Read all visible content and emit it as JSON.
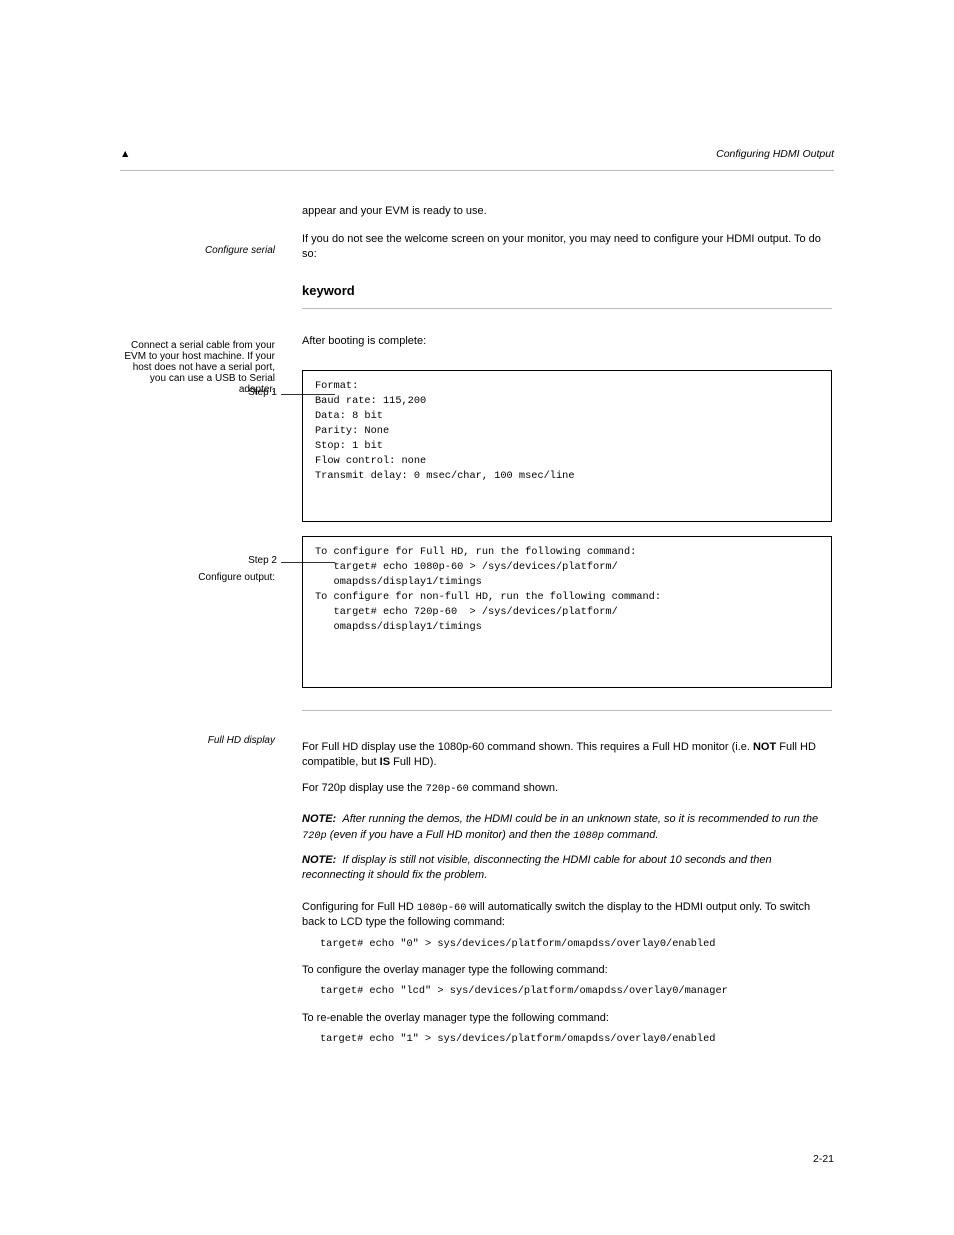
{
  "header": {
    "caret": "▲",
    "title_italic": "Configuring HDMI Output"
  },
  "intro": {
    "line": "appear and your EVM is ready to use.",
    "para": "If you do not see the welcome screen on your monitor, you may need to configure your HDMI output. To do so:"
  },
  "section": {
    "label": "keyword",
    "after_rule": "After booting is complete:"
  },
  "steps": {
    "s1": {
      "text": "Connect a serial cable from your EVM to your host machine. If your host does not have a serial port, you can use a USB to Serial adapter.",
      "label": "Step 1",
      "code": "Format:\nBaud rate: 115,200\nData: 8 bit\nParity: None\nStop: 1 bit\nFlow control: none\nTransmit delay: 0 msec/char, 100 msec/line"
    },
    "s2": {
      "text": "Configure output:",
      "label": "Step 2",
      "code": "To configure for Full HD, run the following command:\n   target# echo 1080p-60 > /sys/devices/platform/\n   omapdss/display1/timings\nTo configure for non-full HD, run the following command:\n   target# echo 720p-60  > /sys/devices/platform/\n   omapdss/display1/timings"
    }
  },
  "full_hd": {
    "p1_pre": "For Full HD display use the 1080p-60 command shown. This requires a Full HD monitor (i.e. ",
    "p1_b1": "NOT",
    "p1_mid": " Full HD compatible, but ",
    "p1_b2": "IS",
    "p1_post": " Full HD).",
    "p2_pre": "For 720p display use the ",
    "p2_mono": "720p-60",
    "p2_post": " command shown."
  },
  "notes": {
    "label": "NOTE:",
    "p1_pre": "After running the demos, the HDMI could be in an unknown state, so it is recommended to run the ",
    "p1_mono": "720p",
    "p1_mid": " (even if you have a Full HD monitor) and then the ",
    "p1_mono2": "1080p",
    "p1_post": " command.",
    "p2": "If display is still not visible, disconnecting the HDMI cable for about 10 seconds and then reconnecting it should fix the problem.",
    "p3_pre": "Configuring for Full HD ",
    "p3_mono": "1080p-60",
    "p3_post": " will automatically switch the display to the HDMI output only. To switch back to LCD type the following command:",
    "c3": "target# echo \"0\" > sys/devices/platform/omapdss/overlay0/enabled",
    "p4": "To configure the overlay manager type the following command:",
    "c4": "target# echo \"lcd\" > sys/devices/platform/omapdss/overlay0/manager",
    "p5": "To re-enable the overlay manager type the following command:",
    "c5": "target# echo \"1\" > sys/devices/platform/omapdss/overlay0/enabled"
  },
  "page_number": "2-21"
}
